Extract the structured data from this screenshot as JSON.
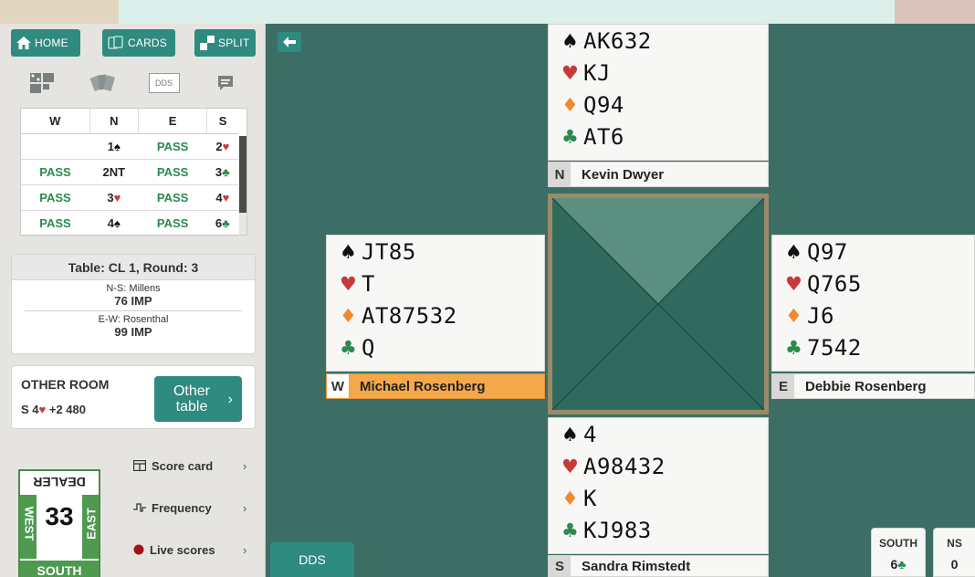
{
  "nav": {
    "home": "HOME",
    "cards": "CARDS",
    "split": "SPLIT"
  },
  "tabs": {
    "dds": "DDS"
  },
  "auction": {
    "headers": [
      "W",
      "N",
      "E",
      "S"
    ],
    "rows": [
      [
        "",
        "1♠",
        "PASS",
        "2♥"
      ],
      [
        "PASS",
        "2NT",
        "PASS",
        "3♣"
      ],
      [
        "PASS",
        "3♥",
        "PASS",
        "4♥"
      ],
      [
        "PASS",
        "4♠",
        "PASS",
        "6♣"
      ]
    ]
  },
  "table_info": {
    "title": "Table: CL 1, Round: 3",
    "ns_label": "N-S:",
    "ns_team": "Millens",
    "ns_score": "76 IMP",
    "ew_label": "E-W:",
    "ew_team": "Rosenthal",
    "ew_score": "99 IMP"
  },
  "other_room": {
    "label": "OTHER ROOM",
    "contract_pre": "S 4",
    "contract_post": "+2 480",
    "button_line1": "Other",
    "button_line2": "table",
    "chevron": "›"
  },
  "dealer": {
    "top": "DEALER",
    "left": "WEST",
    "right": "EAST",
    "bottom": "SOUTH",
    "board": "33"
  },
  "menu": {
    "score_card": "Score card",
    "frequency": "Frequency",
    "live_scores": "Live scores",
    "chevron": "›"
  },
  "dds_button": "DDS",
  "hands": {
    "north": {
      "seat": "N",
      "player": "Kevin Dwyer",
      "spades": "AK632",
      "hearts": "KJ",
      "diamonds": "Q94",
      "clubs": "AT6"
    },
    "west": {
      "seat": "W",
      "player": "Michael Rosenberg",
      "spades": "JT85",
      "hearts": "T",
      "diamonds": "AT87532",
      "clubs": "Q"
    },
    "east": {
      "seat": "E",
      "player": "Debbie Rosenberg",
      "spades": "Q97",
      "hearts": "Q765",
      "diamonds": "J6",
      "clubs": "7542"
    },
    "south": {
      "seat": "S",
      "player": "Sandra Rimstedt",
      "spades": "4",
      "hearts": "A98432",
      "diamonds": "K",
      "clubs": "KJ983"
    }
  },
  "suit_symbols": {
    "spade": "♠",
    "heart": "♥",
    "diamond": "♦",
    "club": "♣"
  },
  "scorebox": {
    "south_label": "SOUTH",
    "south_value": "6♣",
    "ns_label": "NS",
    "ns_value": "0"
  },
  "colors": {
    "felt": "#3d6e66",
    "accent": "#2f8a80",
    "heart": "#c73a3a",
    "diamond": "#f08b2c",
    "club": "#2a8a4e",
    "active_player": "#f4a84a"
  }
}
